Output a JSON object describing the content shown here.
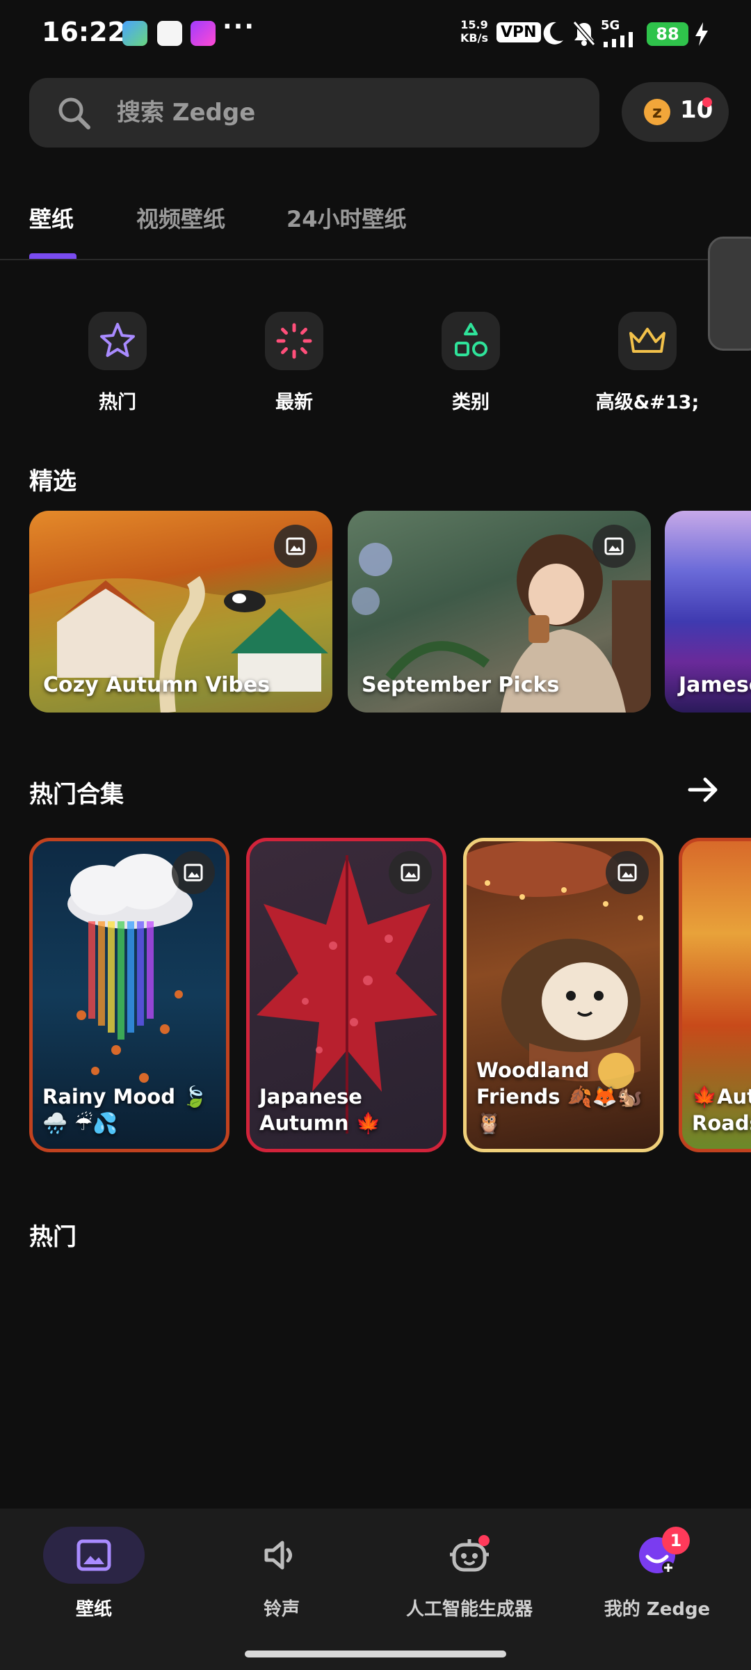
{
  "status_bar": {
    "time": "16:22",
    "net_speed_value": "15.9",
    "net_speed_unit": "KB/s",
    "vpn": "VPN",
    "network": "5G",
    "battery": "88",
    "icons": [
      "app-icon-1",
      "app-icon-2",
      "app-icon-3",
      "moon-icon",
      "mute-bell-icon",
      "signal-icon",
      "charging-icon"
    ]
  },
  "search": {
    "placeholder": "搜索 Zedge",
    "value": ""
  },
  "coins": {
    "count": "10"
  },
  "tabs": [
    {
      "label": "壁纸",
      "active": true
    },
    {
      "label": "视频壁纸",
      "active": false
    },
    {
      "label": "24小时壁纸",
      "active": false
    }
  ],
  "quick_categories": [
    {
      "label": "热门",
      "icon": "star-icon",
      "color": "#a98bff"
    },
    {
      "label": "最新",
      "icon": "burst-icon",
      "color": "#ff4f7a"
    },
    {
      "label": "类别",
      "icon": "shapes-icon",
      "color": "#2fe39a"
    },
    {
      "label": "高级&#13;",
      "icon": "crown-icon",
      "color": "#f2c14a"
    }
  ],
  "featured": {
    "title": "精选",
    "cards": [
      {
        "title": "Cozy Autumn Vibes"
      },
      {
        "title": "September Picks"
      },
      {
        "title": "Jamesc"
      }
    ]
  },
  "collections": {
    "title": "热门合集",
    "cards": [
      {
        "title": "Rainy Mood 🍃🌧️ ☔💦",
        "border": "#c1421f"
      },
      {
        "title": "Japanese Autumn 🍁",
        "border": "#d1233a"
      },
      {
        "title": "Woodland Friends 🍂🦊🐿️ 🦉",
        "border": "#f0d07a"
      },
      {
        "title": "🍁Aut Roads",
        "border": "#c1421f"
      }
    ]
  },
  "popular": {
    "title": "热门"
  },
  "bottom_nav": [
    {
      "label": "壁纸",
      "icon": "image-icon",
      "active": true
    },
    {
      "label": "铃声",
      "icon": "speaker-icon",
      "active": false
    },
    {
      "label": "人工智能生成器",
      "icon": "robot-icon",
      "active": false,
      "dot": true
    },
    {
      "label": "我的 Zedge",
      "icon": "profile-icon",
      "active": false,
      "badge": "1"
    }
  ],
  "colors": {
    "accent": "#7a4cf0",
    "background": "#0f0f0f",
    "notification": "#ff3a5a"
  }
}
